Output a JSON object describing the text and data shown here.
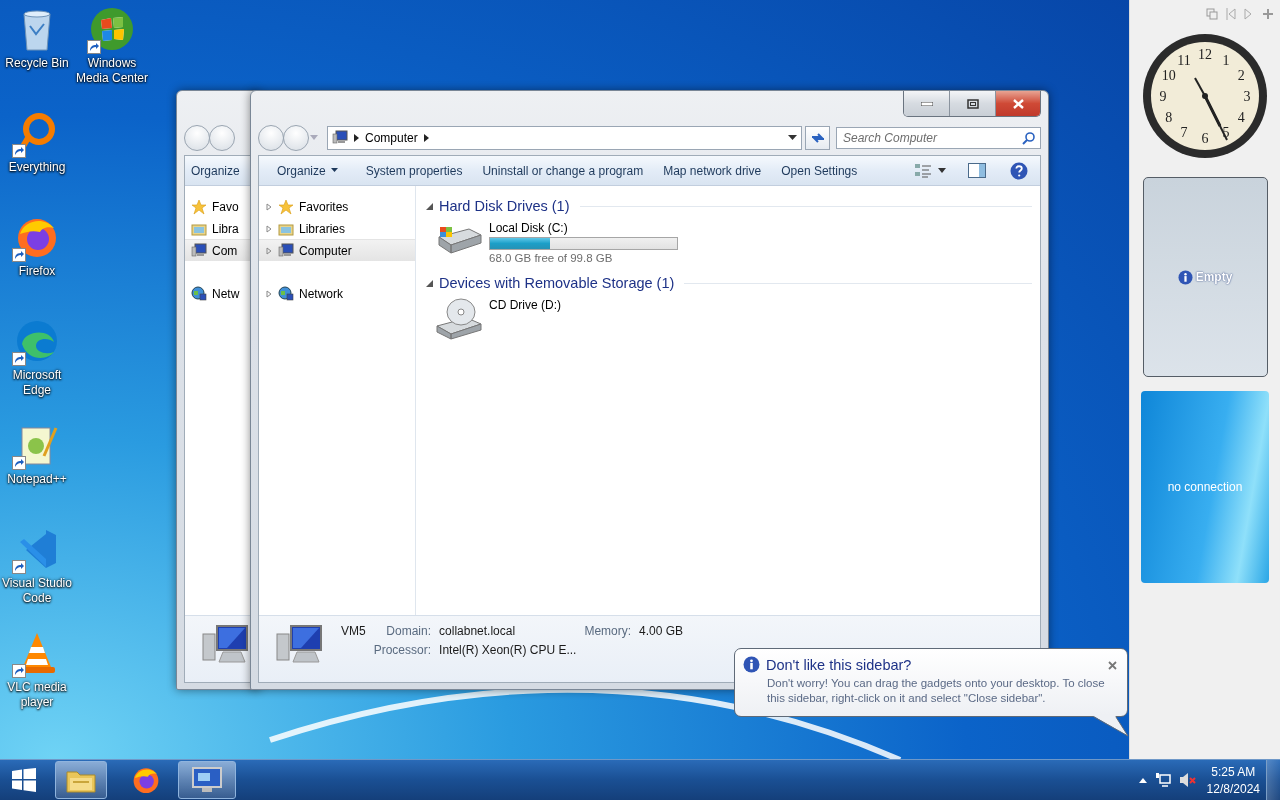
{
  "desktop_icons": [
    {
      "kind": "recycle",
      "label": "Recycle Bin",
      "shortcut": false
    },
    {
      "kind": "media",
      "label": "Windows Media Center",
      "shortcut": true
    },
    {
      "kind": "ring",
      "label": "Everything",
      "shortcut": true
    },
    {
      "kind": "fox",
      "label": "Firefox",
      "shortcut": true
    },
    {
      "kind": "wave",
      "label": "Microsoft Edge",
      "shortcut": true
    },
    {
      "kind": "notepad",
      "label": "Notepad++",
      "shortcut": true
    },
    {
      "kind": "code",
      "label": "Visual Studio Code",
      "shortcut": true
    },
    {
      "kind": "cone",
      "label": "VLC media player",
      "shortcut": true
    }
  ],
  "back_window": {
    "toolbar": "Organize",
    "nav": [
      {
        "kind": "star",
        "label": "Favo",
        "selected": false
      },
      {
        "kind": "library",
        "label": "Libra",
        "selected": false
      },
      {
        "kind": "computer",
        "label": "Com",
        "selected": true
      },
      {
        "kind": "network",
        "label": "Netw",
        "selected": false
      }
    ]
  },
  "explorer": {
    "address": [
      "Computer"
    ],
    "search": {
      "placeholder": "Search Computer"
    },
    "toolbar": [
      {
        "kind": "menu",
        "label": "Organize"
      },
      {
        "kind": "button",
        "label": "System properties"
      },
      {
        "kind": "button",
        "label": "Uninstall or change a program"
      },
      {
        "kind": "button",
        "label": "Map network drive"
      },
      {
        "kind": "button",
        "label": "Open Settings"
      }
    ],
    "nav": [
      {
        "kind": "star",
        "label": "Favorites",
        "selected": false,
        "expanded": false
      },
      {
        "kind": "library",
        "label": "Libraries",
        "selected": false,
        "expanded": false
      },
      {
        "kind": "computer",
        "label": "Computer",
        "selected": true,
        "expanded": false
      },
      {
        "kind": "network",
        "label": "Network",
        "selected": false,
        "expanded": false
      }
    ],
    "groups": [
      {
        "title": "Hard Disk Drives (1)",
        "expanded": true,
        "items": [
          {
            "kind": "disk",
            "name": "Local Disk (C:)",
            "level": 0.32,
            "free": "68.0 GB free of 99.8 GB"
          }
        ]
      },
      {
        "title": "Devices with Removable Storage (1)",
        "expanded": true,
        "items": [
          {
            "kind": "cd",
            "name": "CD Drive (D:)"
          }
        ]
      }
    ],
    "details": {
      "name": "VM5",
      "fields": [
        {
          "label": "Domain:",
          "value": "collabnet.local"
        },
        {
          "label": "Memory:",
          "value": "4.00 GB"
        },
        {
          "label": "Processor:",
          "value": "Intel(R) Xeon(R) CPU E..."
        }
      ]
    }
  },
  "balloon": {
    "title": "Don't like this sidebar?",
    "text": "Don't worry! You can drag the gadgets onto your desktop. To close this sidebar, right-click on it and select \"Close sidebar\"."
  },
  "sidebar": {
    "clock": {
      "numerals": [
        "12",
        "1",
        "2",
        "3",
        "4",
        "5",
        "6",
        "7",
        "8",
        "9",
        "10",
        "11"
      ]
    },
    "empty_gadget": "Empty",
    "feed_gadget": "no connection"
  },
  "taskbar": {
    "buttons": [
      {
        "kind": "folder",
        "running": true
      },
      {
        "kind": "fox",
        "running": false
      },
      {
        "kind": "computer",
        "running": true
      }
    ],
    "time": "5:25 AM",
    "date": "12/8/2024"
  }
}
